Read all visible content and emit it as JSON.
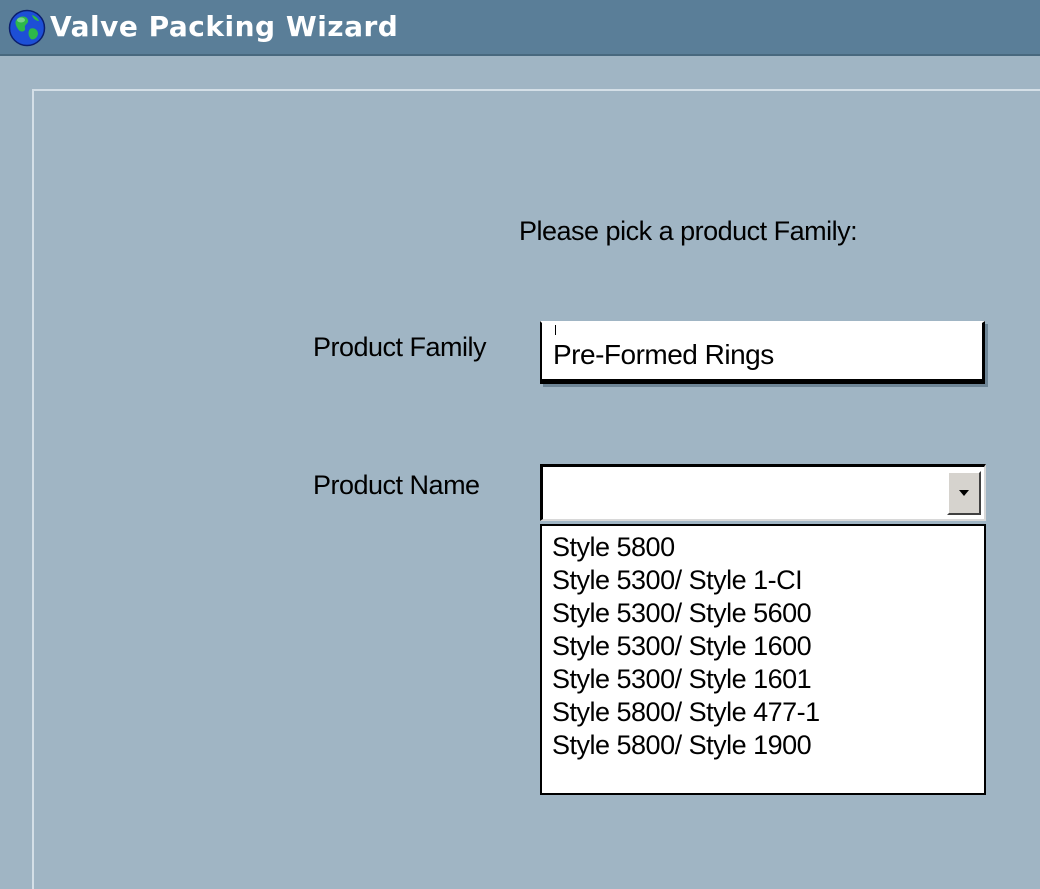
{
  "window": {
    "title": "Valve Packing Wizard",
    "icon": "globe-icon"
  },
  "prompt": "Please pick a product Family:",
  "product_family": {
    "label": "Product Family",
    "value": "Pre-Formed Rings"
  },
  "product_name": {
    "label": "Product Name",
    "value": "",
    "dropdown_icon": "chevron-down-icon",
    "options": [
      "Style 5800",
      "Style 5300/ Style 1-CI",
      "Style 5300/ Style 5600",
      "Style 5300/ Style 1600",
      "Style 5300/ Style 1601",
      "Style 5800/ Style 477-1",
      "Style 5800/ Style 1900"
    ]
  }
}
